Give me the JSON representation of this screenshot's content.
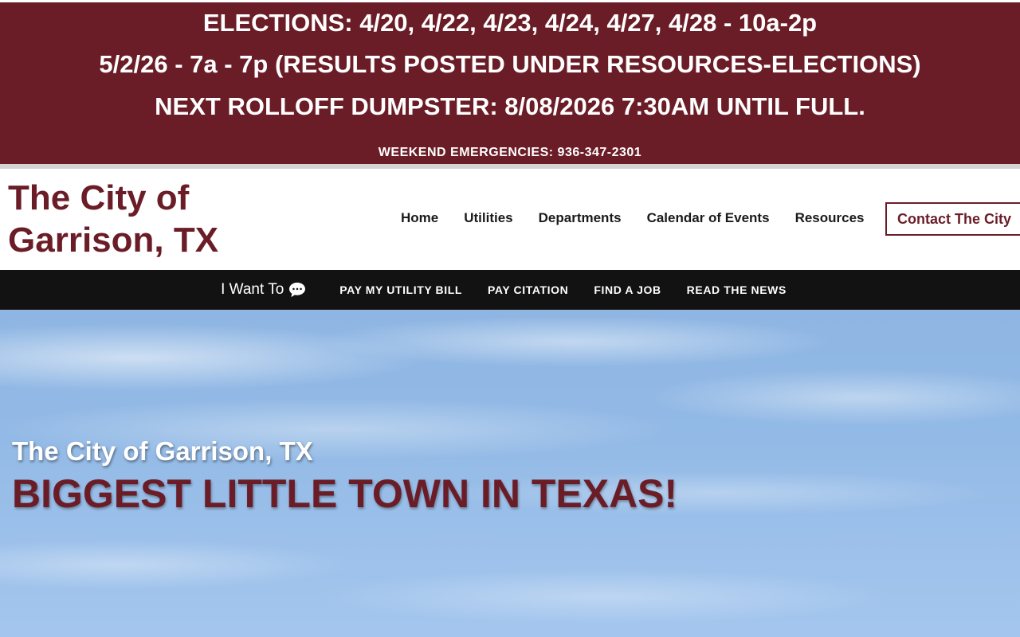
{
  "alert": {
    "line1": "ELECTIONS: 4/20, 4/22, 4/23, 4/24, 4/27, 4/28 - 10a-2p",
    "line2": "5/2/26 - 7a - 7p (RESULTS POSTED UNDER RESOURCES-ELECTIONS)",
    "line3": "NEXT ROLLOFF DUMPSTER: 8/08/2026 7:30AM UNTIL FULL.",
    "emergency": "WEEKEND EMERGENCIES: 936-347-2301"
  },
  "header": {
    "title_line1": "The City of",
    "title_line2": "Garrison, TX",
    "nav": [
      {
        "label": "Home"
      },
      {
        "label": "Utilities"
      },
      {
        "label": "Departments"
      },
      {
        "label": "Calendar of Events"
      },
      {
        "label": "Resources"
      }
    ],
    "contact_label": "Contact The City"
  },
  "quickbar": {
    "iwant_label": "I Want To",
    "iwant_icon": "chat-bubble-icon",
    "links": [
      {
        "label": "PAY MY UTILITY BILL"
      },
      {
        "label": "PAY CITATION"
      },
      {
        "label": "FIND A JOB"
      },
      {
        "label": "READ THE NEWS"
      }
    ]
  },
  "hero": {
    "subtitle": "The City of Garrison, TX",
    "headline": "BIGGEST LITTLE TOWN IN TEXAS!"
  },
  "colors": {
    "brand_maroon": "#6b1d27",
    "quickbar_bg": "#121212",
    "sky": "#93bae6"
  }
}
